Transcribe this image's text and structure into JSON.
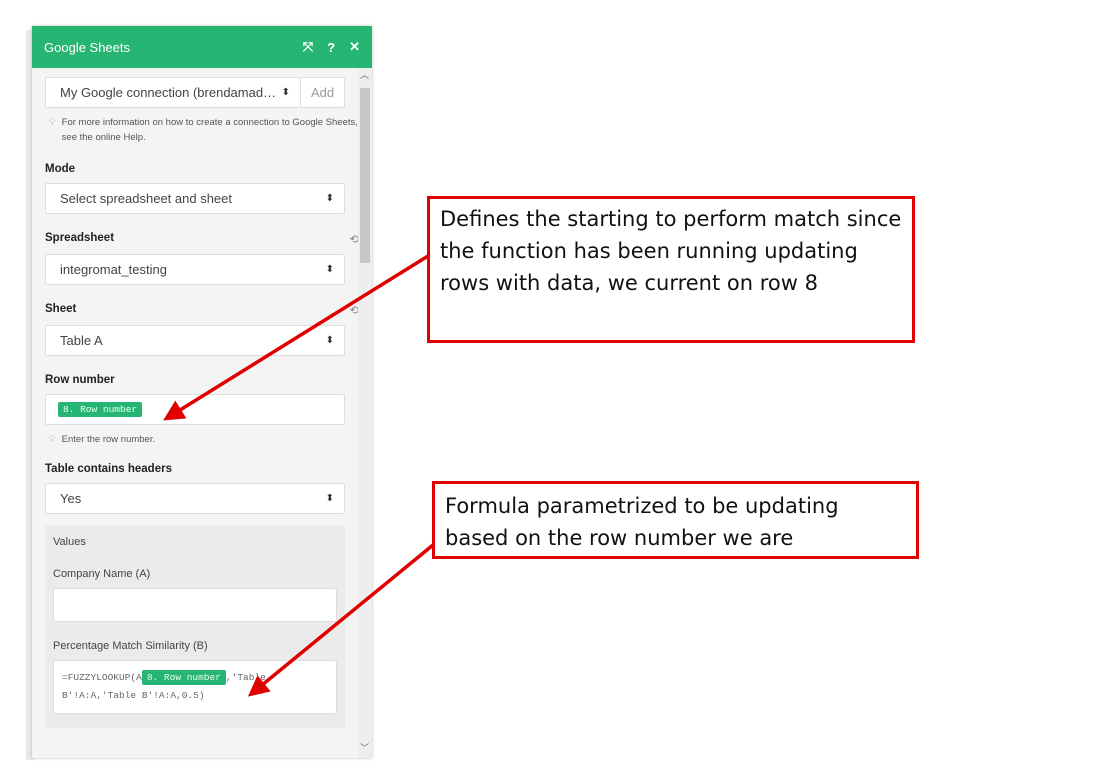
{
  "panel": {
    "title": "Google Sheets",
    "connection": "My Google connection (brendamad…",
    "add_label": "Add",
    "connection_hint": "For more information on how to create a connection to Google Sheets, see the online Help.",
    "mode_label": "Mode",
    "mode_value": "Select spreadsheet and sheet",
    "spreadsheet_label": "Spreadsheet",
    "spreadsheet_value": "integromat_testing",
    "sheet_label": "Sheet",
    "sheet_value": "Table A",
    "row_label": "Row number",
    "row_tag": "8. Row number",
    "row_hint": "Enter the row number.",
    "headers_label": "Table contains headers",
    "headers_value": "Yes",
    "values_label": "Values",
    "company_label": "Company Name (A)",
    "company_value": "",
    "pct_label": "Percentage Match Similarity (B)",
    "formula_prefix": "=FUZZYLOOKUP(A",
    "formula_tag": "8. Row number",
    "formula_suffix": ",'Table B'!A:A,'Table B'!A:A,0.5)"
  },
  "annotations": [
    {
      "text": "Defines the starting to perform match since the function has been running updating rows with data, we current on row 8"
    },
    {
      "text": "Formula parametrized to be updating based on the row number we are"
    }
  ]
}
